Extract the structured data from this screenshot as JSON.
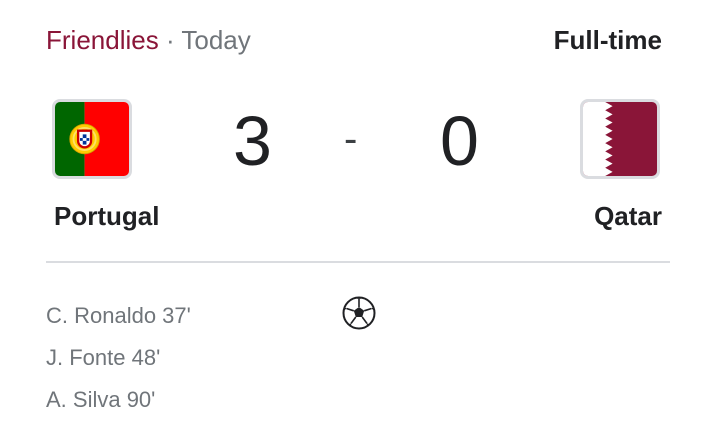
{
  "header": {
    "competition": "Friendlies",
    "separator": "·",
    "date": "Today",
    "status": "Full-time"
  },
  "match": {
    "home": {
      "name": "Portugal",
      "score": "3",
      "flag_icon": "portugal-flag-icon"
    },
    "away": {
      "name": "Qatar",
      "score": "0",
      "flag_icon": "qatar-flag-icon"
    },
    "score_separator": "-"
  },
  "scorers": [
    "C. Ronaldo 37'",
    "J. Fonte 48'",
    "A. Silva 90'"
  ],
  "goal_icon": "soccer-ball-icon",
  "colors": {
    "league_link": "#8a1538",
    "muted_text": "#70757a",
    "primary_text": "#202124",
    "divider": "#dadce0",
    "portugal_green": "#006600",
    "portugal_red": "#ff0000",
    "qatar_maroon": "#8a1538"
  }
}
